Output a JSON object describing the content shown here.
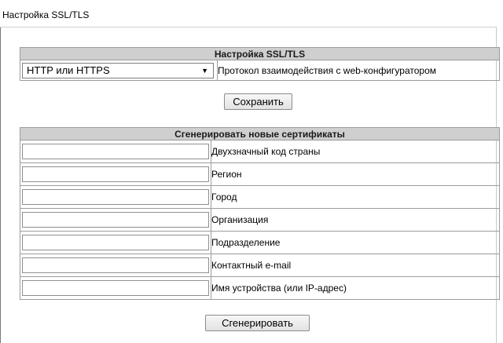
{
  "page": {
    "title": "Настройка SSL/TLS"
  },
  "ssl": {
    "header": "Настройка SSL/TLS",
    "protocol_value": "HTTP или HTTPS",
    "protocol_label": "Протокол взаимодействия с web-конфигуратором",
    "save_label": "Сохранить"
  },
  "certs": {
    "header": "Сгенерировать новые сертификаты",
    "fields": [
      {
        "label": "Двухзначный код страны",
        "value": ""
      },
      {
        "label": "Регион",
        "value": ""
      },
      {
        "label": "Город",
        "value": ""
      },
      {
        "label": "Организация",
        "value": ""
      },
      {
        "label": "Подразделение",
        "value": ""
      },
      {
        "label": "Контактный e-mail",
        "value": ""
      },
      {
        "label": "Имя устройства (или IP-адрес)",
        "value": ""
      }
    ],
    "generate_label": "Сгенерировать"
  }
}
